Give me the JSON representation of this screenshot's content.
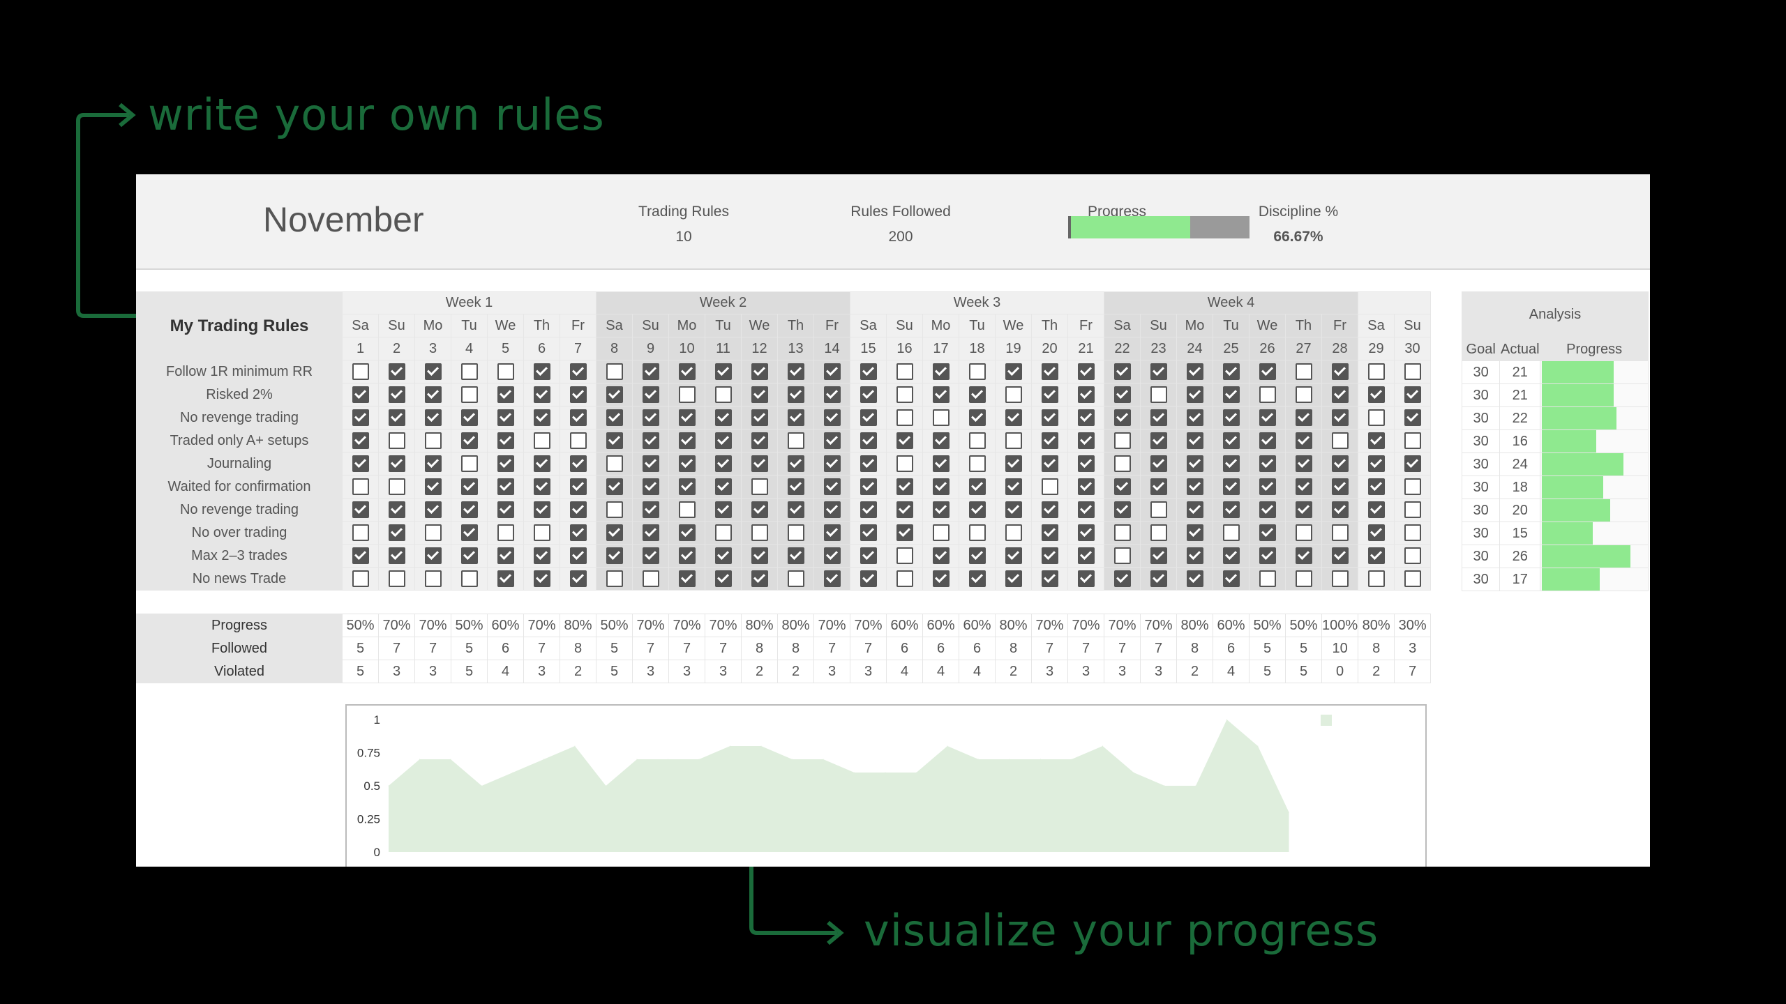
{
  "callouts": {
    "top": "write your own rules",
    "bottom": "visualize your progress"
  },
  "header": {
    "month": "November",
    "trading_rules_label": "Trading Rules",
    "trading_rules_value": "10",
    "rules_followed_label": "Rules Followed",
    "rules_followed_value": "200",
    "progress_label": "Progress",
    "progress_fraction": 0.667,
    "discipline_label": "Discipline %",
    "discipline_value": "66.67%"
  },
  "grid": {
    "title": "My Trading Rules",
    "weeks": [
      "Week 1",
      "Week 2",
      "Week 3",
      "Week 4"
    ],
    "days_of_week": [
      "Sa",
      "Su",
      "Mo",
      "Tu",
      "We",
      "Th",
      "Fr",
      "Sa",
      "Su",
      "Mo",
      "Tu",
      "We",
      "Th",
      "Fr",
      "Sa",
      "Su",
      "Mo",
      "Tu",
      "We",
      "Th",
      "Fr",
      "Sa",
      "Su",
      "Mo",
      "Tu",
      "We",
      "Th",
      "Fr",
      "Sa",
      "Su"
    ],
    "day_numbers": [
      "1",
      "2",
      "3",
      "4",
      "5",
      "6",
      "7",
      "8",
      "9",
      "10",
      "11",
      "12",
      "13",
      "14",
      "15",
      "16",
      "17",
      "18",
      "19",
      "20",
      "21",
      "22",
      "23",
      "24",
      "25",
      "26",
      "27",
      "28",
      "29",
      "30"
    ],
    "rules": [
      {
        "name": "Follow 1R minimum RR",
        "checks": "011001101111111010111111110100"
      },
      {
        "name": "Risked 2%",
        "checks": "111011111001111011011101100111"
      },
      {
        "name": "No revenge trading",
        "checks": "111111111111111001111111111101"
      },
      {
        "name": "Traded only A+ setups",
        "checks": "100110011111011110011011111010"
      },
      {
        "name": "Journaling",
        "checks": "111011101111111010111011111111"
      },
      {
        "name": "Waited for confirmation",
        "checks": "001111111110111111101111111110"
      },
      {
        "name": "No revenge trading",
        "checks": "111111101011111111111101111110"
      },
      {
        "name": "No over trading",
        "checks": "010100111100011100011001010010"
      },
      {
        "name": "Max 2–3 trades",
        "checks": "111111111111111011111011111110"
      },
      {
        "name": "No news Trade",
        "checks": "000011100111011011111111100000"
      }
    ]
  },
  "summary": {
    "progress_label": "Progress",
    "followed_label": "Followed",
    "violated_label": "Violated",
    "progress": [
      "50%",
      "70%",
      "70%",
      "50%",
      "60%",
      "70%",
      "80%",
      "50%",
      "70%",
      "70%",
      "70%",
      "80%",
      "80%",
      "70%",
      "70%",
      "60%",
      "60%",
      "60%",
      "80%",
      "70%",
      "70%",
      "70%",
      "70%",
      "80%",
      "60%",
      "50%",
      "50%",
      "100%",
      "80%",
      "30%"
    ],
    "followed": [
      "5",
      "7",
      "7",
      "5",
      "6",
      "7",
      "8",
      "5",
      "7",
      "7",
      "7",
      "8",
      "8",
      "7",
      "7",
      "6",
      "6",
      "6",
      "8",
      "7",
      "7",
      "7",
      "7",
      "8",
      "6",
      "5",
      "5",
      "10",
      "8",
      "3"
    ],
    "violated": [
      "5",
      "3",
      "3",
      "5",
      "4",
      "3",
      "2",
      "5",
      "3",
      "3",
      "3",
      "2",
      "2",
      "3",
      "3",
      "4",
      "4",
      "4",
      "2",
      "3",
      "3",
      "3",
      "3",
      "2",
      "4",
      "5",
      "5",
      "0",
      "2",
      "7"
    ]
  },
  "analysis": {
    "title": "Analysis",
    "goal_label": "Goal",
    "actual_label": "Actual",
    "progress_label": "Progress",
    "rows": [
      {
        "goal": "30",
        "actual": "21",
        "fraction": 0.7
      },
      {
        "goal": "30",
        "actual": "21",
        "fraction": 0.7
      },
      {
        "goal": "30",
        "actual": "22",
        "fraction": 0.733
      },
      {
        "goal": "30",
        "actual": "16",
        "fraction": 0.533
      },
      {
        "goal": "30",
        "actual": "24",
        "fraction": 0.8
      },
      {
        "goal": "30",
        "actual": "18",
        "fraction": 0.6
      },
      {
        "goal": "30",
        "actual": "20",
        "fraction": 0.667
      },
      {
        "goal": "30",
        "actual": "15",
        "fraction": 0.5
      },
      {
        "goal": "30",
        "actual": "26",
        "fraction": 0.867
      },
      {
        "goal": "30",
        "actual": "17",
        "fraction": 0.567
      }
    ]
  },
  "chart_data": {
    "type": "area",
    "x": [
      1,
      2,
      3,
      4,
      5,
      6,
      7,
      8,
      9,
      10,
      11,
      12,
      13,
      14,
      15,
      16,
      17,
      18,
      19,
      20,
      21,
      22,
      23,
      24,
      25,
      26,
      27,
      28,
      29,
      30
    ],
    "values": [
      0.5,
      0.7,
      0.7,
      0.5,
      0.6,
      0.7,
      0.8,
      0.5,
      0.7,
      0.7,
      0.7,
      0.8,
      0.8,
      0.7,
      0.7,
      0.6,
      0.6,
      0.6,
      0.8,
      0.7,
      0.7,
      0.7,
      0.7,
      0.8,
      0.6,
      0.5,
      0.5,
      1.0,
      0.8,
      0.3
    ],
    "ylim": [
      0,
      1
    ],
    "yticks": [
      "1",
      "0.75",
      "0.5",
      "0.25",
      "0"
    ],
    "grid": false,
    "legend": "top-right",
    "color": "#dfeedd"
  }
}
